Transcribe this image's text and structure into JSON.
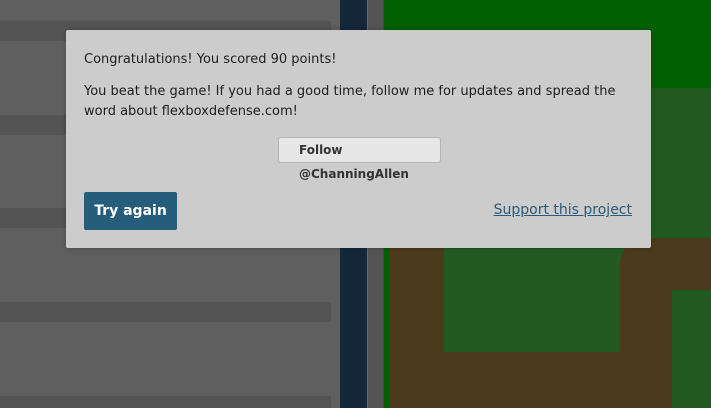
{
  "modal": {
    "score_text": "Congratulations! You scored 90 points!",
    "message_text": "You beat the game! If you had a good time, follow me for updates and spread the word about flexboxdefense.com!",
    "follow_button_label": "Follow @ChanningAllen",
    "try_again_label": "Try again",
    "support_link_label": "Support this project"
  },
  "colors": {
    "overlay_gray": "#5f5f5f",
    "modal_bg": "#cccccc",
    "primary_button": "#255d7b",
    "link": "#2c5a78",
    "board_green": "#006000",
    "grass_green": "#225a22",
    "path_brown": "#4c3a1c",
    "code_column": "#15283a"
  }
}
